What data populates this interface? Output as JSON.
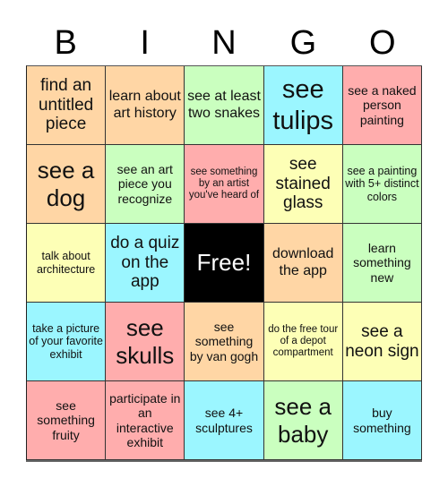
{
  "header": [
    "B",
    "I",
    "N",
    "G",
    "O"
  ],
  "colors": {
    "peach": "#FFD6A5",
    "green": "#CAFFBF",
    "cyan": "#9BF6FF",
    "pink": "#FFADAD",
    "yellow": "#FDFFB6",
    "free": "#000000"
  },
  "cells": [
    {
      "text": "find an untitled piece",
      "color": "peach",
      "size": "s-md"
    },
    {
      "text": "learn about art history",
      "color": "peach",
      "size": "s-sm"
    },
    {
      "text": "see at least two snakes",
      "color": "green",
      "size": "s-sm"
    },
    {
      "text": "see tulips",
      "color": "cyan",
      "size": "s-xl"
    },
    {
      "text": "see a naked person painting",
      "color": "pink",
      "size": "s-xs"
    },
    {
      "text": "see a dog",
      "color": "peach",
      "size": "s-lg"
    },
    {
      "text": "see an art piece you recognize",
      "color": "green",
      "size": "s-xs"
    },
    {
      "text": "see something by an artist you've heard of",
      "color": "pink",
      "size": "s-tiny"
    },
    {
      "text": "see stained glass",
      "color": "yellow",
      "size": "s-md"
    },
    {
      "text": "see a painting with 5+ distinct colors",
      "color": "green",
      "size": "s-xxs"
    },
    {
      "text": "talk about architecture",
      "color": "yellow",
      "size": "s-xxs"
    },
    {
      "text": "do a quiz on the app",
      "color": "cyan",
      "size": "s-md"
    },
    {
      "text": "Free!",
      "color": "free",
      "size": "s-lg",
      "free": true
    },
    {
      "text": "download the app",
      "color": "peach",
      "size": "s-sm"
    },
    {
      "text": "learn something new",
      "color": "green",
      "size": "s-xs"
    },
    {
      "text": "take a picture of your favorite exhibit",
      "color": "cyan",
      "size": "s-xxs"
    },
    {
      "text": "see skulls",
      "color": "pink",
      "size": "s-lg"
    },
    {
      "text": "see something by van gogh",
      "color": "peach",
      "size": "s-xs"
    },
    {
      "text": "do the free tour of a depot compartment",
      "color": "yellow",
      "size": "s-tiny"
    },
    {
      "text": "see a neon sign",
      "color": "yellow",
      "size": "s-md"
    },
    {
      "text": "see something fruity",
      "color": "pink",
      "size": "s-xs"
    },
    {
      "text": "participate in an interactive exhibit",
      "color": "pink",
      "size": "s-xs"
    },
    {
      "text": "see 4+ sculptures",
      "color": "cyan",
      "size": "s-xs"
    },
    {
      "text": "see a baby",
      "color": "green",
      "size": "s-lg"
    },
    {
      "text": "buy something",
      "color": "cyan",
      "size": "s-xs"
    }
  ]
}
